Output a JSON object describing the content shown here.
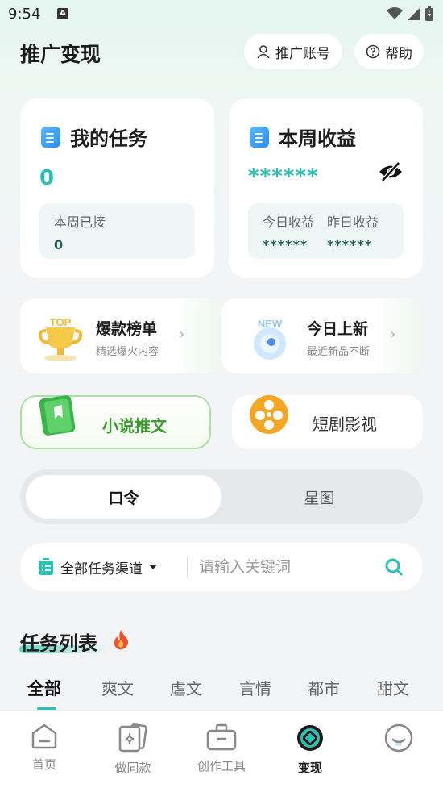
{
  "status_bar": {
    "time": "9:54",
    "notification_glyph": "A"
  },
  "header": {
    "title": "推广变现",
    "account_button": "推广账号",
    "help_button": "帮助"
  },
  "my_tasks": {
    "title": "我的任务",
    "count": "0",
    "week_label": "本周已接",
    "week_value": "0"
  },
  "weekly_income": {
    "title": "本周收益",
    "hidden_value": "******",
    "today_label": "今日收益",
    "today_value": "******",
    "yesterday_label": "昨日收益",
    "yesterday_value": "******"
  },
  "promos": [
    {
      "title": "爆款榜单",
      "subtitle": "精选爆火内容",
      "badge": "TOP"
    },
    {
      "title": "今日上新",
      "subtitle": "最近新品不断",
      "badge": "NEW"
    }
  ],
  "categories": [
    {
      "label": "小说推文",
      "active": true,
      "color": "#3a9a2c"
    },
    {
      "label": "短剧影视",
      "active": false,
      "color": "#333333"
    }
  ],
  "segment": {
    "active": "口令",
    "other": "星图"
  },
  "search": {
    "filter_label": "全部任务渠道",
    "placeholder": "请输入关键词"
  },
  "task_list": {
    "title": "任务列表",
    "tabs": [
      "全部",
      "爽文",
      "虐文",
      "言情",
      "都市",
      "甜文"
    ],
    "active_tab": 0
  },
  "bottom_nav": [
    {
      "label": "首页",
      "icon": "home-icon"
    },
    {
      "label": "做同款",
      "icon": "sparkle-cards-icon"
    },
    {
      "label": "创作工具",
      "icon": "toolbox-icon"
    },
    {
      "label": "变现",
      "icon": "monetize-icon",
      "active": true
    },
    {
      "label": "",
      "icon": "profile-icon"
    }
  ],
  "colors": {
    "accent": "#2bc0b4",
    "novel_green": "#3a9a2c",
    "drama_orange": "#f5a623"
  }
}
